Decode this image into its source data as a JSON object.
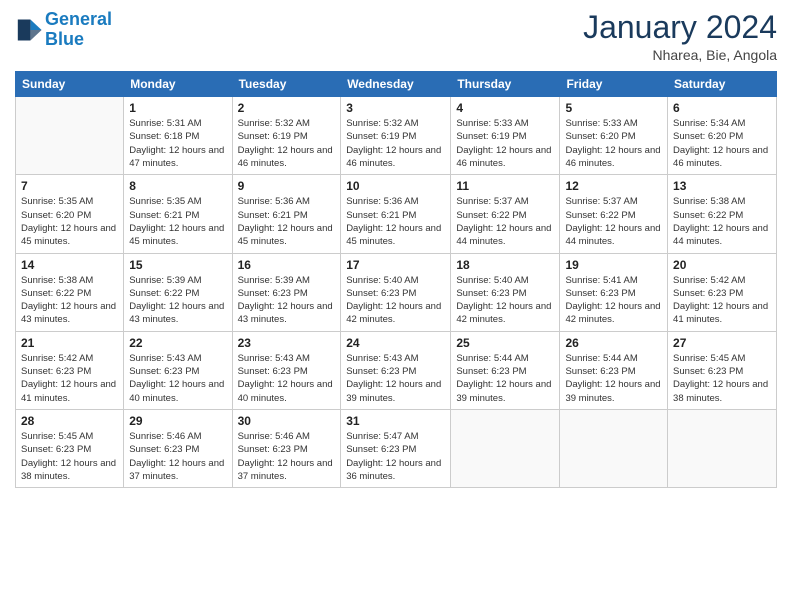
{
  "logo": {
    "line1": "General",
    "line2": "Blue"
  },
  "title": "January 2024",
  "subtitle": "Nharea, Bie, Angola",
  "days_of_week": [
    "Sunday",
    "Monday",
    "Tuesday",
    "Wednesday",
    "Thursday",
    "Friday",
    "Saturday"
  ],
  "weeks": [
    [
      {
        "day": "",
        "info": ""
      },
      {
        "day": "1",
        "info": "Sunrise: 5:31 AM\nSunset: 6:18 PM\nDaylight: 12 hours\nand 47 minutes."
      },
      {
        "day": "2",
        "info": "Sunrise: 5:32 AM\nSunset: 6:19 PM\nDaylight: 12 hours\nand 46 minutes."
      },
      {
        "day": "3",
        "info": "Sunrise: 5:32 AM\nSunset: 6:19 PM\nDaylight: 12 hours\nand 46 minutes."
      },
      {
        "day": "4",
        "info": "Sunrise: 5:33 AM\nSunset: 6:19 PM\nDaylight: 12 hours\nand 46 minutes."
      },
      {
        "day": "5",
        "info": "Sunrise: 5:33 AM\nSunset: 6:20 PM\nDaylight: 12 hours\nand 46 minutes."
      },
      {
        "day": "6",
        "info": "Sunrise: 5:34 AM\nSunset: 6:20 PM\nDaylight: 12 hours\nand 46 minutes."
      }
    ],
    [
      {
        "day": "7",
        "info": "Sunrise: 5:35 AM\nSunset: 6:20 PM\nDaylight: 12 hours\nand 45 minutes."
      },
      {
        "day": "8",
        "info": "Sunrise: 5:35 AM\nSunset: 6:21 PM\nDaylight: 12 hours\nand 45 minutes."
      },
      {
        "day": "9",
        "info": "Sunrise: 5:36 AM\nSunset: 6:21 PM\nDaylight: 12 hours\nand 45 minutes."
      },
      {
        "day": "10",
        "info": "Sunrise: 5:36 AM\nSunset: 6:21 PM\nDaylight: 12 hours\nand 45 minutes."
      },
      {
        "day": "11",
        "info": "Sunrise: 5:37 AM\nSunset: 6:22 PM\nDaylight: 12 hours\nand 44 minutes."
      },
      {
        "day": "12",
        "info": "Sunrise: 5:37 AM\nSunset: 6:22 PM\nDaylight: 12 hours\nand 44 minutes."
      },
      {
        "day": "13",
        "info": "Sunrise: 5:38 AM\nSunset: 6:22 PM\nDaylight: 12 hours\nand 44 minutes."
      }
    ],
    [
      {
        "day": "14",
        "info": "Sunrise: 5:38 AM\nSunset: 6:22 PM\nDaylight: 12 hours\nand 43 minutes."
      },
      {
        "day": "15",
        "info": "Sunrise: 5:39 AM\nSunset: 6:22 PM\nDaylight: 12 hours\nand 43 minutes."
      },
      {
        "day": "16",
        "info": "Sunrise: 5:39 AM\nSunset: 6:23 PM\nDaylight: 12 hours\nand 43 minutes."
      },
      {
        "day": "17",
        "info": "Sunrise: 5:40 AM\nSunset: 6:23 PM\nDaylight: 12 hours\nand 42 minutes."
      },
      {
        "day": "18",
        "info": "Sunrise: 5:40 AM\nSunset: 6:23 PM\nDaylight: 12 hours\nand 42 minutes."
      },
      {
        "day": "19",
        "info": "Sunrise: 5:41 AM\nSunset: 6:23 PM\nDaylight: 12 hours\nand 42 minutes."
      },
      {
        "day": "20",
        "info": "Sunrise: 5:42 AM\nSunset: 6:23 PM\nDaylight: 12 hours\nand 41 minutes."
      }
    ],
    [
      {
        "day": "21",
        "info": "Sunrise: 5:42 AM\nSunset: 6:23 PM\nDaylight: 12 hours\nand 41 minutes."
      },
      {
        "day": "22",
        "info": "Sunrise: 5:43 AM\nSunset: 6:23 PM\nDaylight: 12 hours\nand 40 minutes."
      },
      {
        "day": "23",
        "info": "Sunrise: 5:43 AM\nSunset: 6:23 PM\nDaylight: 12 hours\nand 40 minutes."
      },
      {
        "day": "24",
        "info": "Sunrise: 5:43 AM\nSunset: 6:23 PM\nDaylight: 12 hours\nand 39 minutes."
      },
      {
        "day": "25",
        "info": "Sunrise: 5:44 AM\nSunset: 6:23 PM\nDaylight: 12 hours\nand 39 minutes."
      },
      {
        "day": "26",
        "info": "Sunrise: 5:44 AM\nSunset: 6:23 PM\nDaylight: 12 hours\nand 39 minutes."
      },
      {
        "day": "27",
        "info": "Sunrise: 5:45 AM\nSunset: 6:23 PM\nDaylight: 12 hours\nand 38 minutes."
      }
    ],
    [
      {
        "day": "28",
        "info": "Sunrise: 5:45 AM\nSunset: 6:23 PM\nDaylight: 12 hours\nand 38 minutes."
      },
      {
        "day": "29",
        "info": "Sunrise: 5:46 AM\nSunset: 6:23 PM\nDaylight: 12 hours\nand 37 minutes."
      },
      {
        "day": "30",
        "info": "Sunrise: 5:46 AM\nSunset: 6:23 PM\nDaylight: 12 hours\nand 37 minutes."
      },
      {
        "day": "31",
        "info": "Sunrise: 5:47 AM\nSunset: 6:23 PM\nDaylight: 12 hours\nand 36 minutes."
      },
      {
        "day": "",
        "info": ""
      },
      {
        "day": "",
        "info": ""
      },
      {
        "day": "",
        "info": ""
      }
    ]
  ]
}
